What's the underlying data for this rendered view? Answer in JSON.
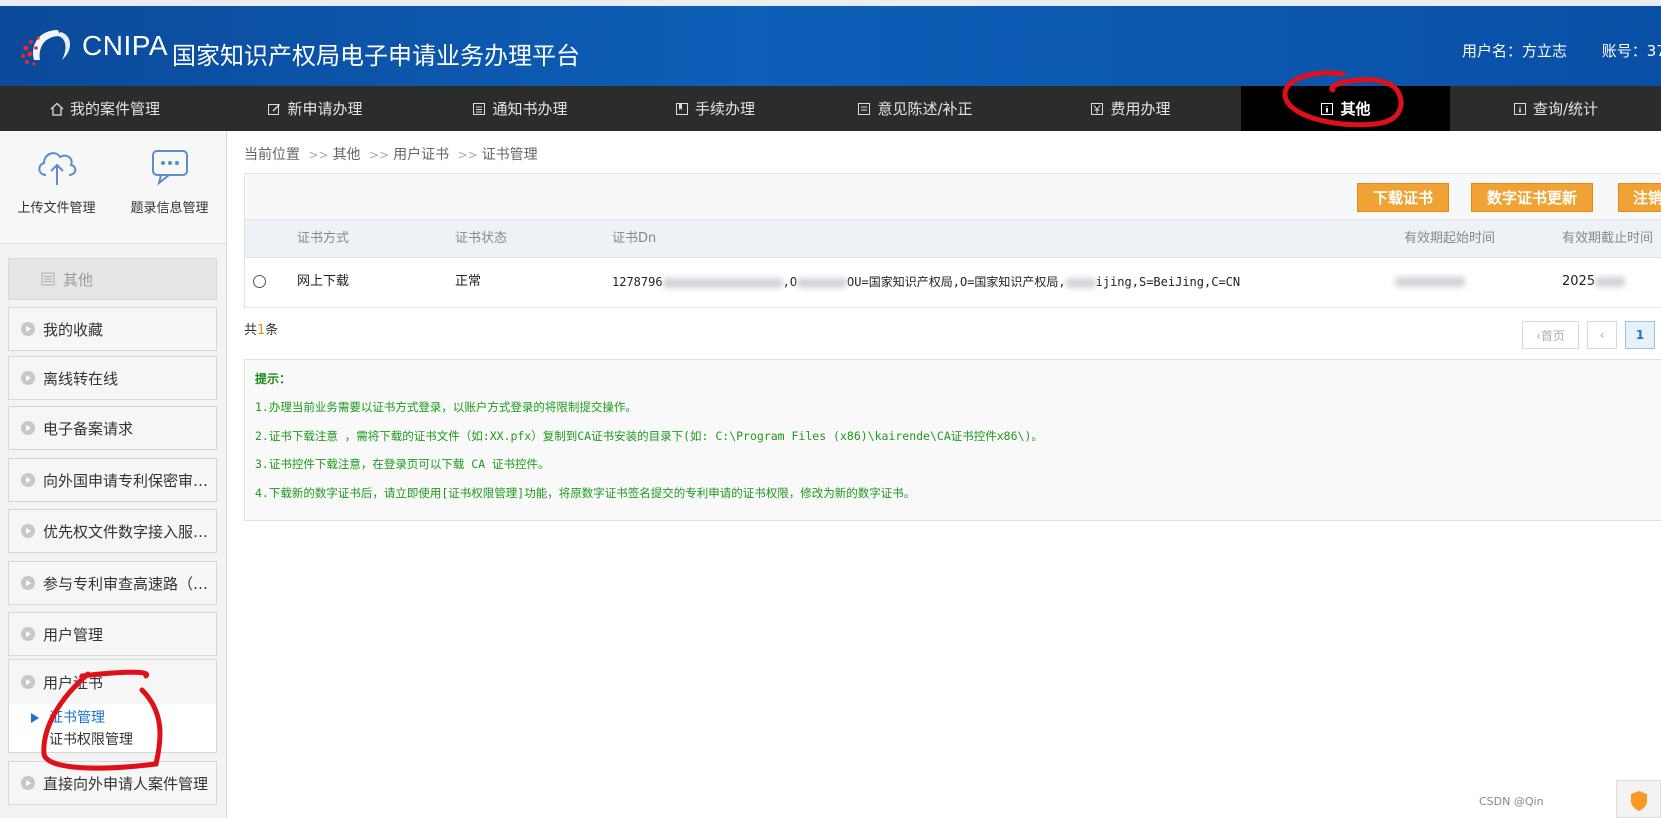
{
  "header": {
    "brand": "CNIPA",
    "title": "国家知识产权局电子申请业务办理平台",
    "user_label": "用户名：方立志",
    "account_label": "账号：37",
    "bg_color": "#0d5fb8"
  },
  "nav": {
    "items": [
      {
        "label": "我的案件管理",
        "icon": "home-icon"
      },
      {
        "label": "新申请办理",
        "icon": "edit-icon"
      },
      {
        "label": "通知书办理",
        "icon": "list-icon"
      },
      {
        "label": "手续办理",
        "icon": "bookmark-icon"
      },
      {
        "label": "意见陈述/补正",
        "icon": "document-icon"
      },
      {
        "label": "费用办理",
        "icon": "yen-icon"
      },
      {
        "label": "其他",
        "icon": "info-icon",
        "active": true
      },
      {
        "label": "查询/统计",
        "icon": "info-icon"
      }
    ]
  },
  "sidebar": {
    "tools": [
      {
        "label": "上传文件管理",
        "icon": "cloud-upload-icon"
      },
      {
        "label": "题录信息管理",
        "icon": "chat-icon"
      }
    ],
    "section_title": "其他",
    "items": [
      {
        "label": "我的收藏"
      },
      {
        "label": "离线转在线"
      },
      {
        "label": "电子备案请求"
      },
      {
        "label": "向外国申请专利保密审…"
      },
      {
        "label": "优先权文件数字接入服…"
      },
      {
        "label": "参与专利审查高速路（…"
      },
      {
        "label": "用户管理"
      }
    ],
    "group": {
      "label": "用户证书",
      "children": [
        {
          "label": "证书管理",
          "active": true
        },
        {
          "label": "证书权限管理"
        }
      ]
    },
    "last_item": "直接向外申请人案件管理"
  },
  "breadcrumb": {
    "prefix": "当前位置",
    "items": [
      "其他",
      "用户证书",
      "证书管理"
    ],
    "separator": ">>"
  },
  "toolbar": {
    "download": "下载证书",
    "update": "数字证书更新",
    "cancel": "注销"
  },
  "table": {
    "headers": [
      "证书方式",
      "证书状态",
      "证书Dn",
      "有效期起始时间",
      "有效期截止时间"
    ],
    "rows": [
      {
        "method": "网上下载",
        "status": "正常",
        "dn_prefix": "1",
        "dn_part1": "278796",
        "dn_part2": ",O",
        "dn_visible": "OU=国家知识产权局,O=国家知识产权局,",
        "dn_suffix": "ijing,S=BeiJing,C=CN",
        "end_partial": "2025"
      }
    ]
  },
  "total": {
    "prefix": "共",
    "count": "1",
    "suffix": "条"
  },
  "pager": {
    "first": "‹首页",
    "prev": "‹",
    "current": "1"
  },
  "tips": {
    "title": "提示：",
    "lines": [
      "1.办理当前业务需要以证书方式登录，以账户方式登录的将限制提交操作。",
      "2.证书下载注意 ，需将下载的证书文件（如:XX.pfx）复制到CA证书安装的目录下(如: C:\\Program Files (x86)\\kairende\\CA证书控件x86\\)。",
      "3.证书控件下载注意，在登录页可以下载 CA 证书控件。",
      "4.下载新的数字证书后，请立即使用[证书权限管理]功能，将原数字证书签名提交的专利申请的证书权限，修改为新的数字证书。"
    ]
  },
  "watermark": "CSDN @Qin",
  "colors": {
    "accent": "#f0a234",
    "nav_bg": "#2c2c2c",
    "tip_green": "#1e9a1e",
    "annotation_red": "#e0101a"
  }
}
